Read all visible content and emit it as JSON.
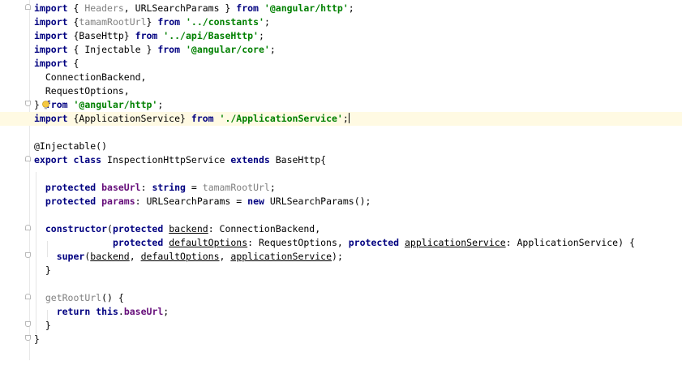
{
  "editor": {
    "lines": {
      "l1": {
        "kw1": "import",
        "t1": " { ",
        "unused1": "Headers",
        "t2": ", URLSearchParams } ",
        "kw2": "from",
        "t3": " ",
        "str1": "'@angular/http'",
        "t4": ";"
      },
      "l2": {
        "kw1": "import",
        "t1": " {",
        "unused1": "tamamRootUrl",
        "t2": "} ",
        "kw2": "from",
        "t3": " ",
        "str1": "'../constants'",
        "t4": ";"
      },
      "l3": {
        "kw1": "import",
        "t1": " {BaseHttp} ",
        "kw2": "from",
        "t3": " ",
        "str1": "'../api/BaseHttp'",
        "t4": ";"
      },
      "l4": {
        "kw1": "import",
        "t1": " { Injectable } ",
        "kw2": "from",
        "t3": " ",
        "str1": "'@angular/core'",
        "t4": ";"
      },
      "l5": {
        "kw1": "import",
        "t1": " {"
      },
      "l6": {
        "t1": "  ConnectionBackend,"
      },
      "l7": {
        "t1": "  RequestOptions,"
      },
      "l8": {
        "t1": "} ",
        "kw1": "from",
        "t2": " ",
        "str1": "'@angular/http'",
        "t3": ";"
      },
      "l9": {
        "kw1": "import",
        "t1": " {ApplicationService} ",
        "kw2": "from",
        "t2": " ",
        "str1": "'./ApplicationService'",
        "t3": ";"
      },
      "l10": {
        "t1": ""
      },
      "l11": {
        "t1": "@Injectable()"
      },
      "l12": {
        "kw1": "export class",
        "t1": " InspectionHttpService ",
        "kw2": "extends",
        "t2": " BaseHttp{"
      },
      "l13": {
        "t1": ""
      },
      "l14": {
        "t0": "  ",
        "kw1": "protected",
        "t1": " ",
        "fld1": "baseUrl",
        "t2": ": ",
        "kw2": "string",
        "t3": " = ",
        "gray1": "tamamRootUrl",
        "t4": ";"
      },
      "l15": {
        "t0": "  ",
        "kw1": "protected",
        "t1": " ",
        "fld1": "params",
        "t2": ": URLSearchParams = ",
        "kw2": "new",
        "t3": " URLSearchParams();"
      },
      "l16": {
        "t1": ""
      },
      "l17": {
        "t0": "  ",
        "kw1": "constructor",
        "t1": "(",
        "kw2": "protected",
        "t2": " ",
        "u1": "backend",
        "t3": ": ConnectionBackend,"
      },
      "l18": {
        "t0": "              ",
        "kw1": "protected",
        "t1": " ",
        "u1": "defaultOptions",
        "t2": ": RequestOptions, ",
        "kw2": "protected",
        "t3": " ",
        "u2": "applicationService",
        "t4": ": ApplicationService) {"
      },
      "l19": {
        "t0": "    ",
        "kw1": "super",
        "t1": "(",
        "u1": "backend",
        "t2": ", ",
        "u2": "defaultOptions",
        "t3": ", ",
        "u3": "applicationService",
        "t4": ");"
      },
      "l20": {
        "t0": "  ",
        "t1": "}"
      },
      "l21": {
        "t1": ""
      },
      "l22": {
        "t0": "  ",
        "gray1": "getRootUrl",
        "t1": "() {"
      },
      "l23": {
        "t0": "    ",
        "kw1": "return",
        "t1": " ",
        "kw2": "this",
        "t2": ".",
        "fld1": "baseUrl",
        "t3": ";"
      },
      "l24": {
        "t0": "  ",
        "t1": "}"
      },
      "l25": {
        "t1": "}"
      }
    }
  },
  "colors": {
    "keyword": "#000080",
    "string": "#008000",
    "field": "#660e7a",
    "unused": "#808080",
    "current_line": "#fffae3"
  },
  "icons": {
    "intention": "lightbulb-icon"
  }
}
